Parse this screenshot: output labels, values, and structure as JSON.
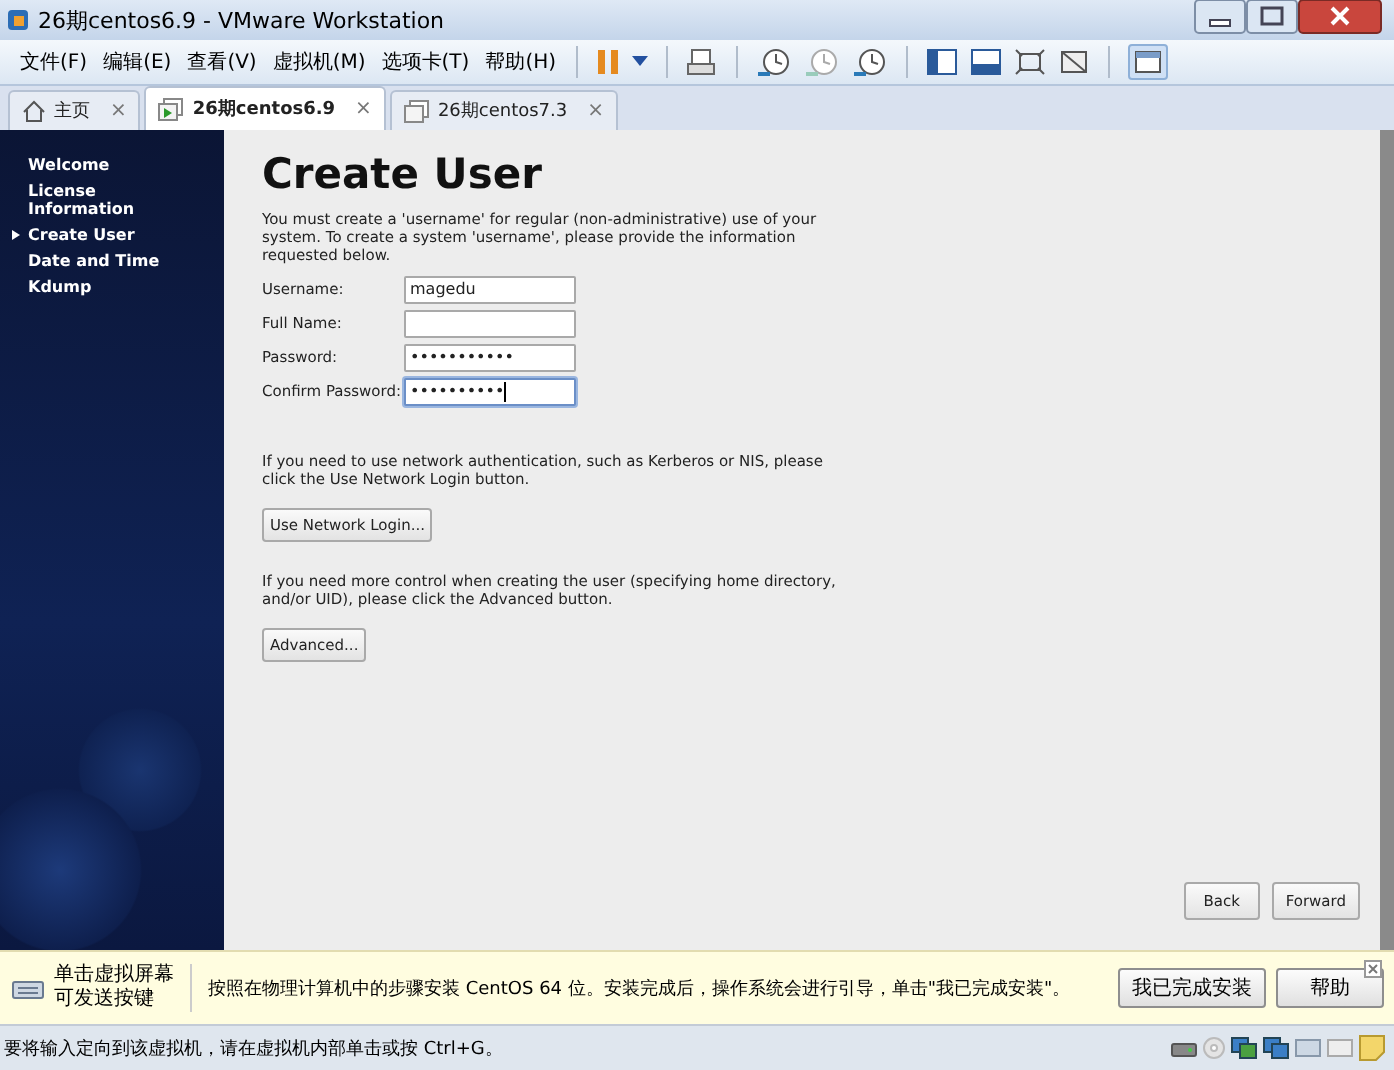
{
  "window": {
    "title": "26期centos6.9 - VMware Workstation"
  },
  "menu": [
    {
      "label": "文件(F)"
    },
    {
      "label": "编辑(E)"
    },
    {
      "label": "查看(V)"
    },
    {
      "label": "虚拟机(M)"
    },
    {
      "label": "选项卡(T)"
    },
    {
      "label": "帮助(H)"
    }
  ],
  "tabs": [
    {
      "label": "主页",
      "kind": "home",
      "selected": false,
      "close": "×"
    },
    {
      "label": "26期centos6.9",
      "kind": "vm",
      "selected": true,
      "close": "×"
    },
    {
      "label": "26期centos7.3",
      "kind": "vm",
      "selected": false,
      "close": "×"
    }
  ],
  "sidebar": {
    "items": [
      {
        "label": "Welcome",
        "selected": false
      },
      {
        "label": "License Information",
        "selected": false
      },
      {
        "label": "Create User",
        "selected": true
      },
      {
        "label": "Date and Time",
        "selected": false
      },
      {
        "label": "Kdump",
        "selected": false
      }
    ]
  },
  "page": {
    "title": "Create User",
    "intro": "You must create a 'username' for regular (non-administrative) use of your system.  To create a system 'username', please provide the information requested below.",
    "fields": [
      {
        "label": "Username:",
        "value": "magedu",
        "focused": false
      },
      {
        "label": "Full Name:",
        "focused": false
      },
      {
        "label": "Password:",
        "value": "•••••••••••",
        "focused": false
      },
      {
        "label": "Confirm Password:",
        "value": "••••••••••",
        "focused": true
      }
    ],
    "network_note": "If you need to use network authentication, such as Kerberos or NIS, please click the Use Network Login button.",
    "network_button": "Use Network Login...",
    "advanced_note": "If you need more control when creating the user (specifying home directory, and/or UID), please click the Advanced button.",
    "advanced_button": "Advanced...",
    "nav_buttons": [
      "Back",
      "Forward"
    ]
  },
  "notification": {
    "hint": [
      "单击虚拟屏幕",
      "可发送按键"
    ],
    "message": "按照在物理计算机中的步骤安装 CentOS 64 位。安装完成后，操作系统会进行引导，单击\"我已完成安装\"。",
    "buttons": [
      "我已完成安装",
      "帮助"
    ]
  },
  "status_bar": {
    "text": "要将输入定向到该虚拟机，请在虚拟机内部单击或按 Ctrl+G。"
  }
}
